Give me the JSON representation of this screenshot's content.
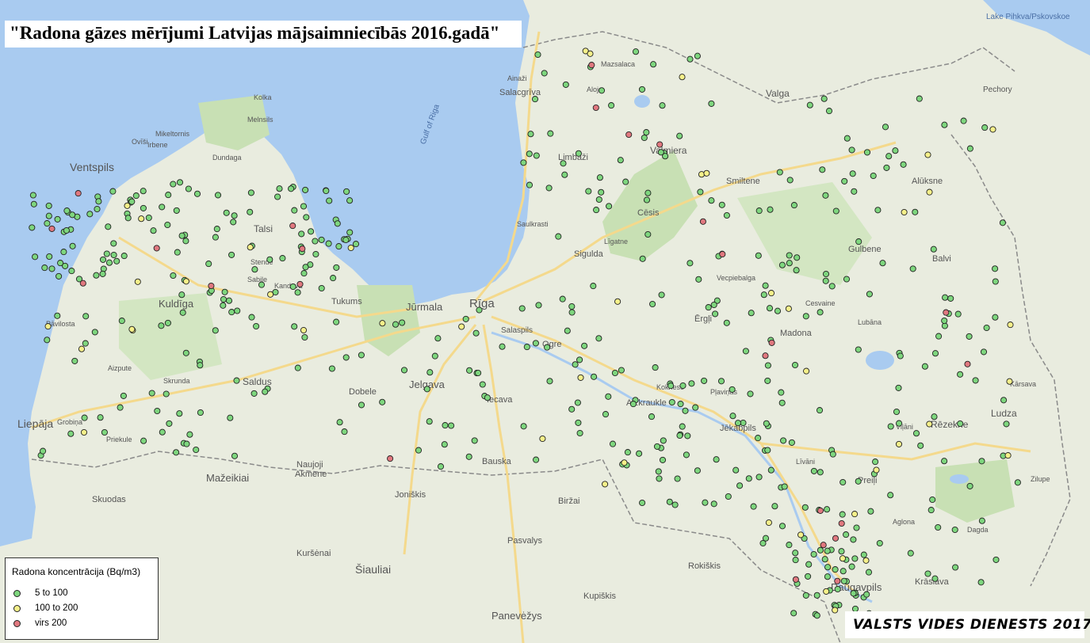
{
  "title": "\"Radona gāzes mērījumi Latvijas mājsaimniecībās 2016.gadā\"",
  "credit": "VALSTS VIDES DIENESTS 2017",
  "legend": {
    "title": "Radona koncentrācija (Bq/m3)",
    "items": [
      {
        "label": "5 to 100",
        "color": "#7ed67e"
      },
      {
        "label": "100 to 200",
        "color": "#f5f08a"
      },
      {
        "label": "virs 200",
        "color": "#e0787f"
      }
    ]
  },
  "colors": {
    "sea": "#a9cbf0",
    "land": "#e9ecdf",
    "forest": "#c8e0b4",
    "border": "#8a8a8a",
    "road": "#f4d98c"
  },
  "place_labels": [
    "Ventspils",
    "Liepāja",
    "Kuldīga",
    "Talsi",
    "Tukums",
    "Jūrmala",
    "Rīga",
    "Jelgava",
    "Dobele",
    "Saldus",
    "Sigulda",
    "Cēsis",
    "Valmiera",
    "Limbaži",
    "Salacgrīva",
    "Ogre",
    "Aizkraukle",
    "Jēkabpils",
    "Madona",
    "Gulbene",
    "Alūksne",
    "Balvi",
    "Rēzekne",
    "Ludza",
    "Preiļi",
    "Daugavpils",
    "Krāslava",
    "Valga",
    "Mažeikiai",
    "Šiauliai",
    "Joniškis",
    "Panevėžys",
    "Biržai",
    "Pasvalys",
    "Kupiškis",
    "Rokiškis",
    "Skuodas",
    "Kuršėnai",
    "Akmene",
    "Naujoji",
    "Bauska",
    "Iecava",
    "Smiltene",
    "Ērgļi",
    "Kolka",
    "Dundaga",
    "Pāvilosta",
    "Aizpute",
    "Skrunda",
    "Priekule",
    "Grobiņa",
    "Alūksne",
    "Viļāni",
    "Līvāni",
    "Aglona",
    "Dagda",
    "Zilupe",
    "Kārsava",
    "Lubāna",
    "Cesvaine",
    "Koknese",
    "Pļaviņas",
    "Vecpiebalga",
    "Līgatne",
    "Saulkrasti",
    "Aloja",
    "Mazsalaca",
    "Ainaži",
    "Pechory",
    "Lake Pihkva/Pskovskoe",
    "Gulf of Riga",
    "Ogre",
    "Salaspils",
    "Kandava",
    "Sabile",
    "Stende",
    "Irbene",
    "Mikeltornis",
    "Ovīši",
    "Melnsils"
  ],
  "measurements": {
    "green": 520,
    "yellow": 45,
    "red": 25
  }
}
